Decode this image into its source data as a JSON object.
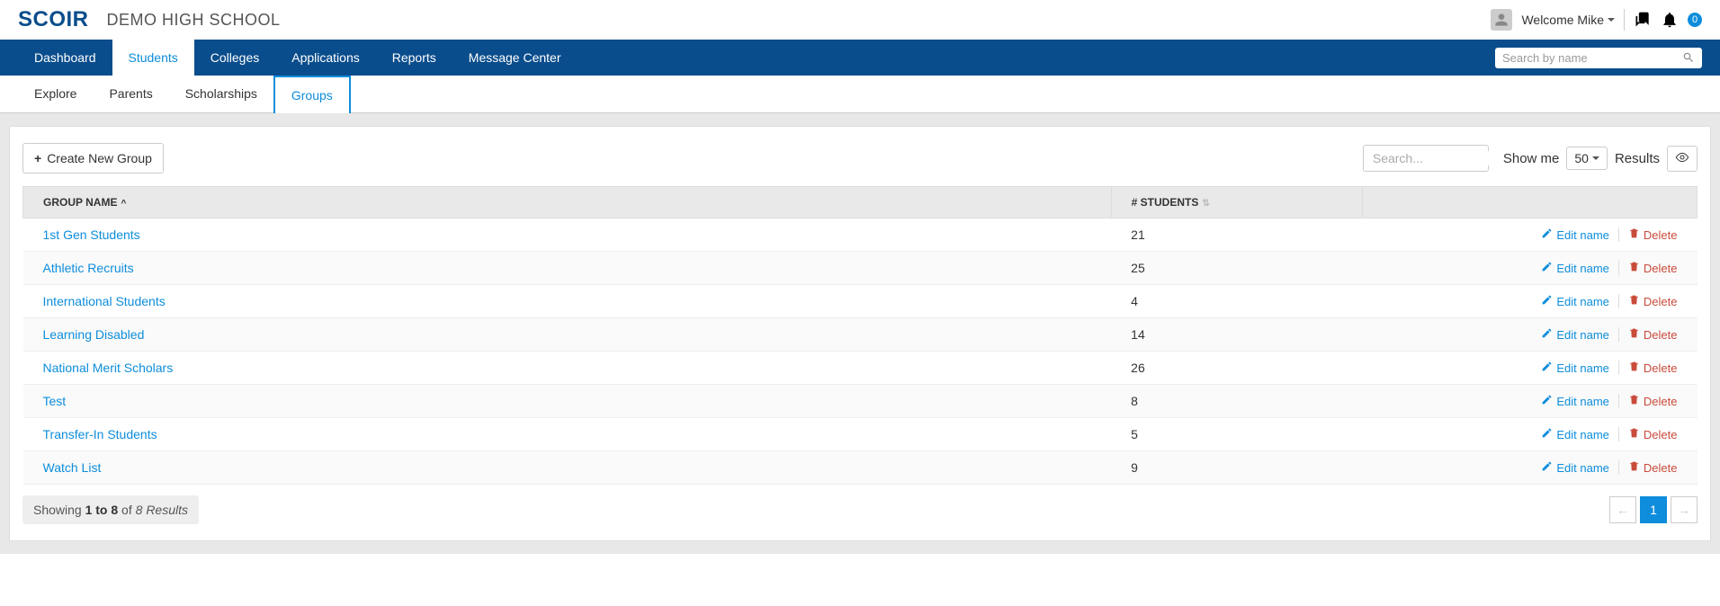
{
  "header": {
    "logo": "SCOIR",
    "school_name": "DEMO HIGH SCHOOL",
    "welcome": "Welcome Mike",
    "notif_count": "0"
  },
  "main_nav": {
    "tabs": [
      "Dashboard",
      "Students",
      "Colleges",
      "Applications",
      "Reports",
      "Message Center"
    ],
    "active_index": 1,
    "search_placeholder": "Search by name"
  },
  "sub_nav": {
    "tabs": [
      "Explore",
      "Parents",
      "Scholarships",
      "Groups"
    ],
    "active_index": 3
  },
  "toolbar": {
    "create_label": "Create New Group",
    "table_search_placeholder": "Search...",
    "show_me_label": "Show me",
    "page_size": "50",
    "results_label": "Results"
  },
  "table": {
    "col_group": "GROUP NAME",
    "col_students": "# STUDENTS",
    "edit_label": "Edit name",
    "delete_label": "Delete",
    "rows": [
      {
        "name": "1st Gen Students",
        "count": "21"
      },
      {
        "name": "Athletic Recruits",
        "count": "25"
      },
      {
        "name": "International Students",
        "count": "4"
      },
      {
        "name": "Learning Disabled",
        "count": "14"
      },
      {
        "name": "National Merit Scholars",
        "count": "26"
      },
      {
        "name": "Test",
        "count": "8"
      },
      {
        "name": "Transfer-In Students",
        "count": "5"
      },
      {
        "name": "Watch List",
        "count": "9"
      }
    ]
  },
  "footer": {
    "showing_prefix": "Showing ",
    "range": "1 to 8",
    "of": " of ",
    "total": "8 Results",
    "current_page": "1"
  }
}
